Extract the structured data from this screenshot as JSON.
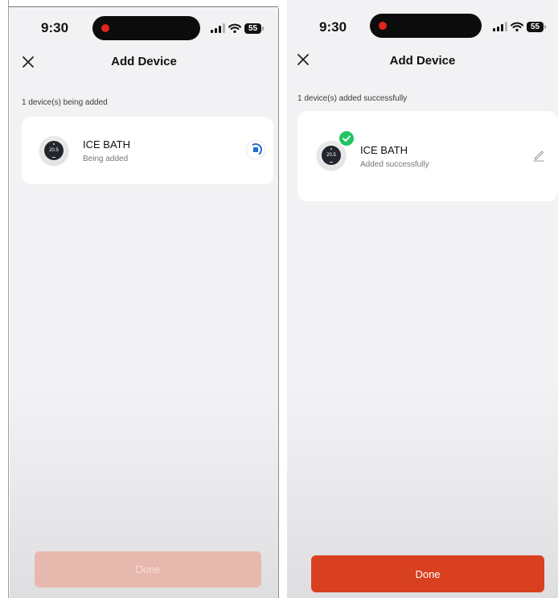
{
  "colors": {
    "accent": "#d9401f",
    "accent_disabled": "#e7b8ad",
    "success": "#22c463",
    "spinner": "#1f6fd3",
    "background": "#f2f2f4"
  },
  "screens": [
    {
      "status": {
        "time": "9:30",
        "battery": "55"
      },
      "header": {
        "title": "Add Device",
        "close_icon": "close-icon"
      },
      "progress_label": "1 device(s) being added",
      "device": {
        "name": "ICE BATH",
        "status": "Being added",
        "display": "20.5",
        "state": "adding",
        "indicator_icon": "loading-spinner-icon"
      },
      "done_button": {
        "label": "Done",
        "enabled": false
      }
    },
    {
      "status": {
        "time": "9:30",
        "battery": "55"
      },
      "header": {
        "title": "Add Device",
        "close_icon": "close-icon"
      },
      "progress_label": "1 device(s) added successfully",
      "device": {
        "name": "ICE BATH",
        "status": "Added successfully",
        "display": "20.5",
        "state": "added",
        "indicator_icon": "edit-pencil-icon",
        "badge_icon": "check-circle-icon"
      },
      "done_button": {
        "label": "Done",
        "enabled": true
      }
    }
  ]
}
